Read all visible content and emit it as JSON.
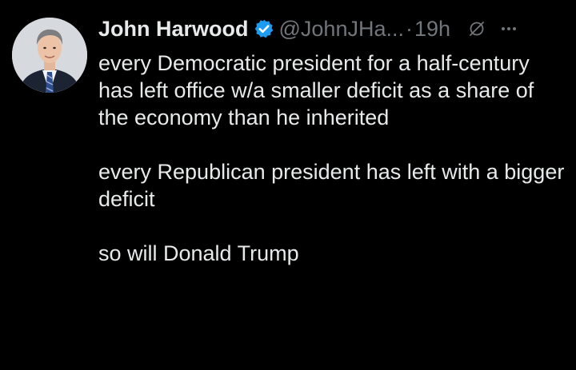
{
  "author": {
    "name": "John Harwood",
    "handle": "@JohnJHa...",
    "separator": "·",
    "time": "19h"
  },
  "icons": {
    "verified": "verified-badge-icon",
    "grok": "grok-icon",
    "more": "more-options-icon"
  },
  "colors": {
    "background": "#000000",
    "text": "#e7e9ea",
    "muted": "#71767b",
    "verified_blue": "#1d9bf0"
  },
  "tweet": {
    "paragraph_1": "every Democratic president for a half-century has left office w/a smaller deficit as a share of the economy than he inherited",
    "paragraph_2": "every Republican president has left with a bigger deficit",
    "paragraph_3": "so will Donald Trump"
  }
}
